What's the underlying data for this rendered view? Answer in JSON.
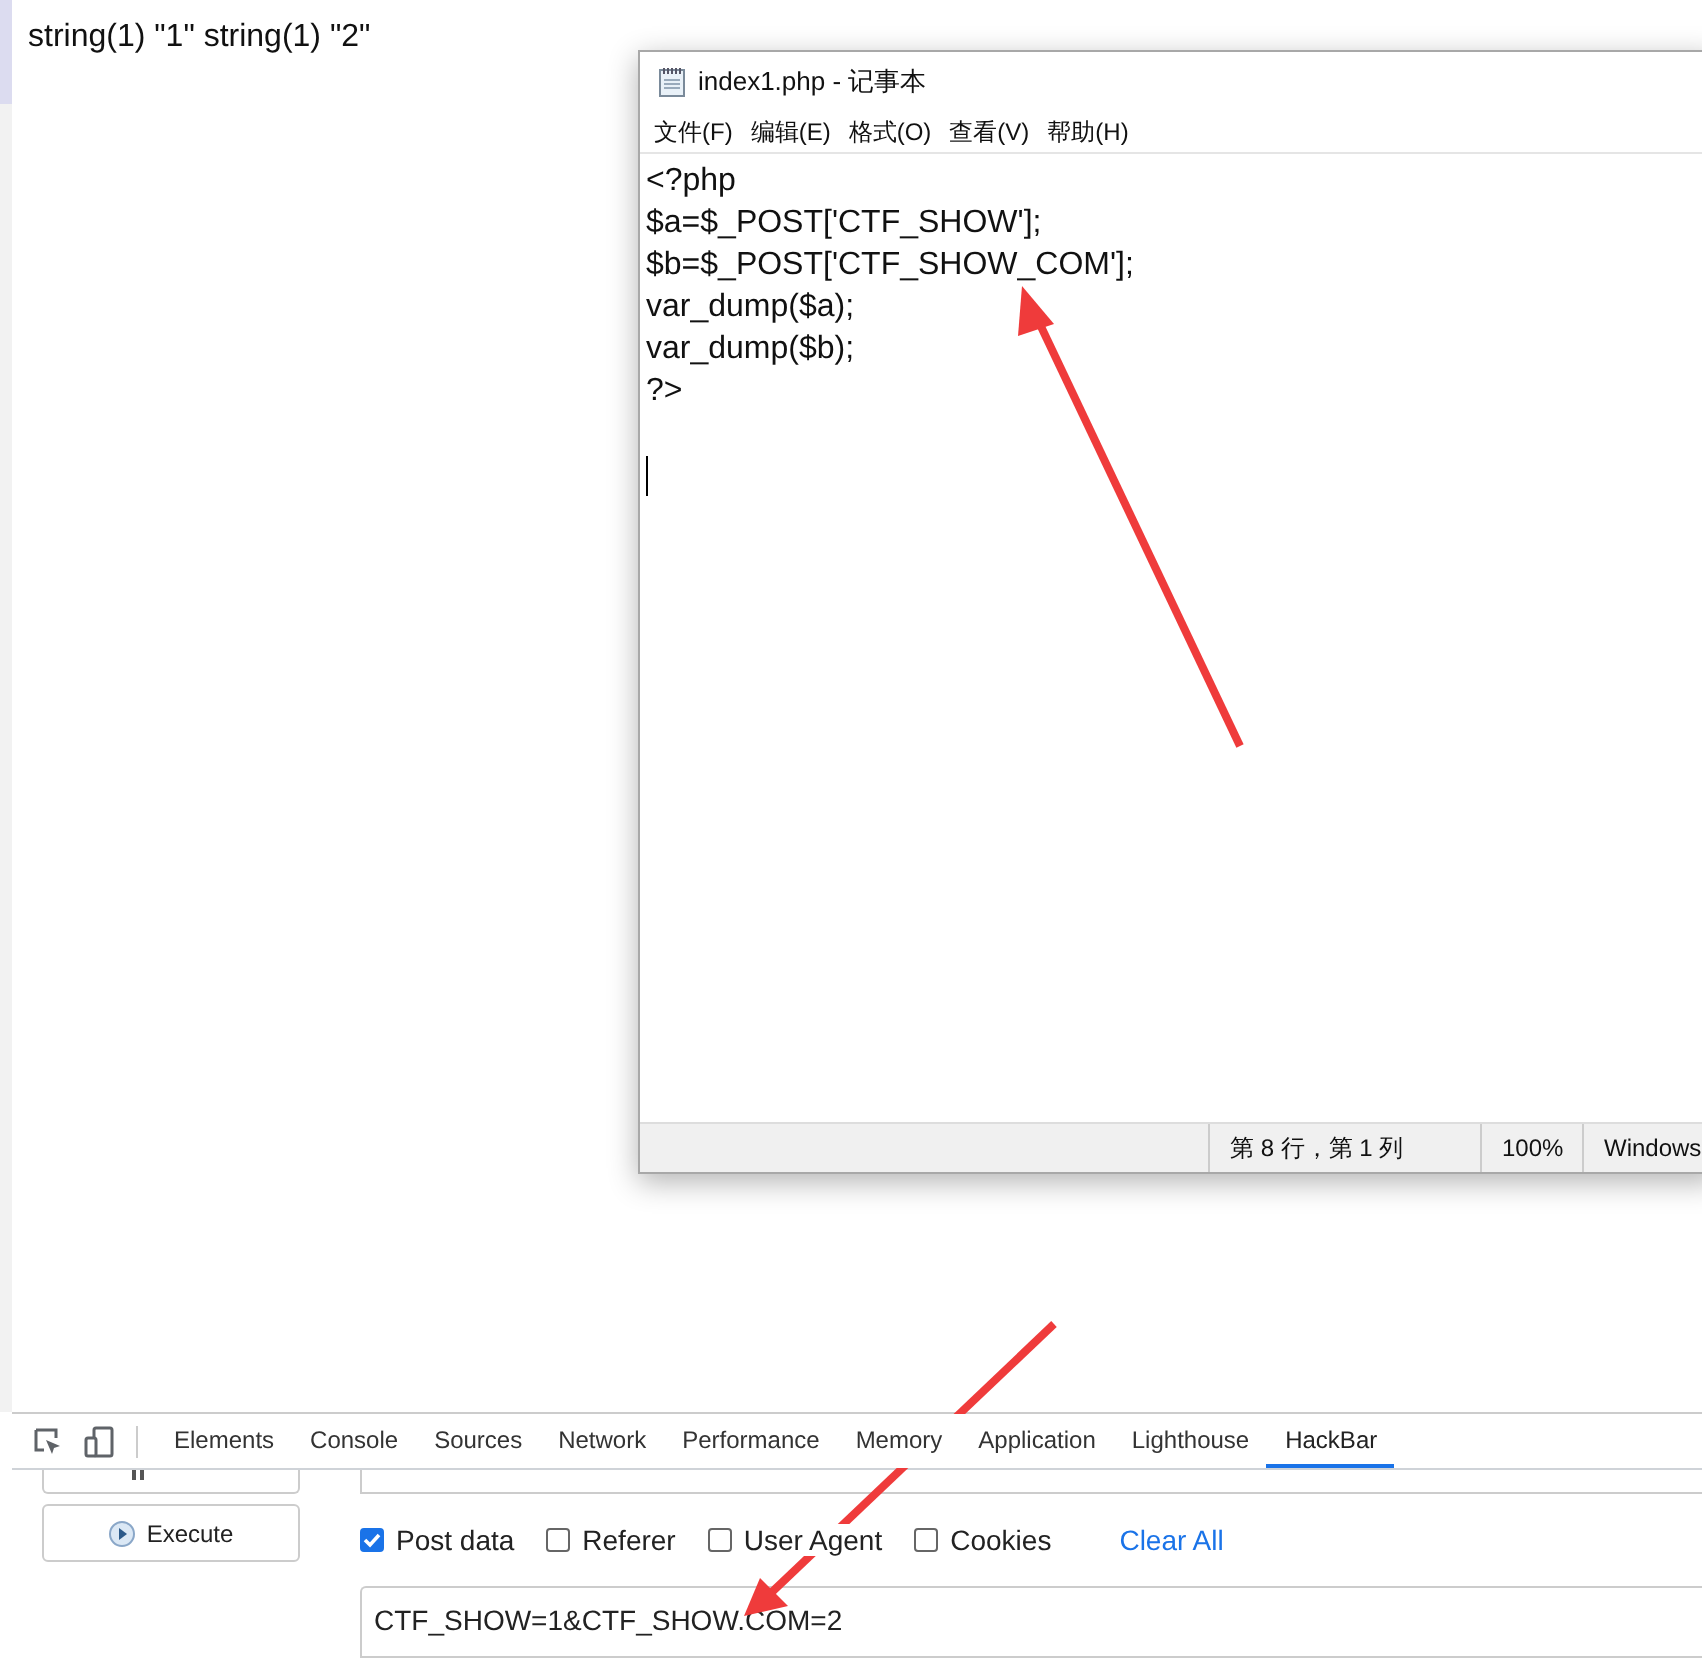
{
  "page_output": "string(1) \"1\" string(1) \"2\"",
  "notepad": {
    "title": "index1.php - 记事本",
    "menu": [
      "文件(F)",
      "编辑(E)",
      "格式(O)",
      "查看(V)",
      "帮助(H)"
    ],
    "lines": [
      "<?php",
      "$a=$_POST['CTF_SHOW'];",
      "$b=$_POST['CTF_SHOW_COM'];",
      "var_dump($a);",
      "var_dump($b);",
      "?>"
    ],
    "status_bar": {
      "position": "第 8 行，第 1 列",
      "zoom": "100%",
      "encoding": "Windows"
    }
  },
  "devtools": {
    "tabs": [
      {
        "label": "Elements",
        "selected": false
      },
      {
        "label": "Console",
        "selected": false
      },
      {
        "label": "Sources",
        "selected": false
      },
      {
        "label": "Network",
        "selected": false
      },
      {
        "label": "Performance",
        "selected": false
      },
      {
        "label": "Memory",
        "selected": false
      },
      {
        "label": "Application",
        "selected": false
      },
      {
        "label": "Lighthouse",
        "selected": false
      },
      {
        "label": "HackBar",
        "selected": true
      }
    ],
    "hackbar": {
      "execute_button": "Execute",
      "options": [
        {
          "label": "Post data",
          "checked": true
        },
        {
          "label": "Referer",
          "checked": false
        },
        {
          "label": "User Agent",
          "checked": false
        },
        {
          "label": "Cookies",
          "checked": false
        }
      ],
      "clear_all": "Clear All",
      "post_data": "CTF_SHOW=1&CTF_SHOW.COM=2"
    }
  }
}
